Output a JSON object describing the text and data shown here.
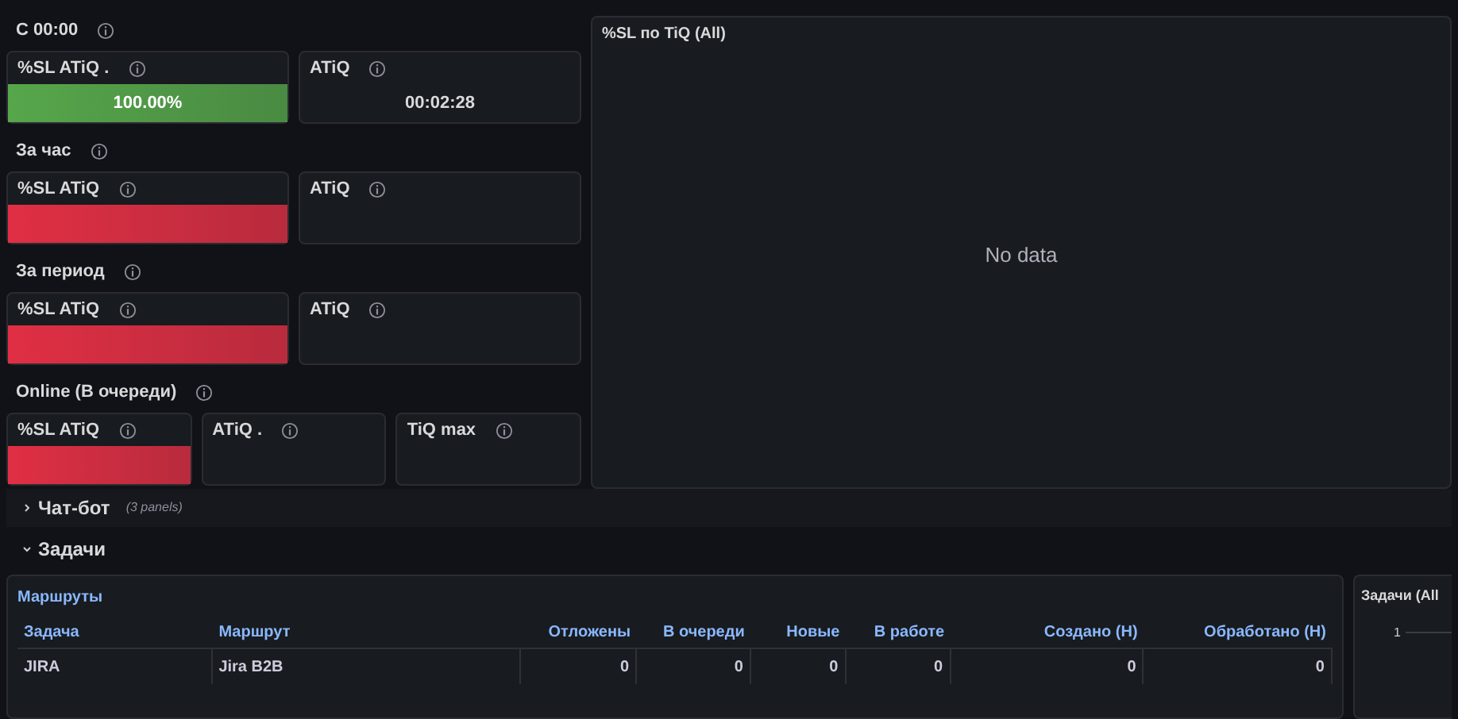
{
  "groups": [
    {
      "title": "С 00:00",
      "panels": [
        {
          "kind": "bar",
          "title": "%SL ATiQ .",
          "color": "#56a64b",
          "value": "100.00%"
        },
        {
          "kind": "value",
          "title": "ATiQ",
          "value": "00:02:28"
        }
      ]
    },
    {
      "title": "За час",
      "panels": [
        {
          "kind": "bar",
          "title": "%SL ATiQ",
          "color": "#e02f44"
        },
        {
          "kind": "value",
          "title": "ATiQ"
        }
      ]
    },
    {
      "title": "За период",
      "panels": [
        {
          "kind": "bar",
          "title": "%SL ATiQ",
          "color": "#e02f44"
        },
        {
          "kind": "value",
          "title": "ATiQ"
        }
      ]
    },
    {
      "title": "Online (В очереди)",
      "panels": [
        {
          "kind": "bar",
          "title": "%SL ATiQ",
          "color": "#e02f44"
        },
        {
          "kind": "value",
          "title": "ATiQ ."
        },
        {
          "kind": "value",
          "title": "TiQ max"
        }
      ]
    }
  ],
  "sl_panel": {
    "title": "%SL по TiQ (All)",
    "message": "No data"
  },
  "rows": [
    {
      "title": "Чат-бот",
      "expanded": false,
      "note": "(3 panels)"
    },
    {
      "title": "Задачи",
      "expanded": true
    }
  ],
  "table": {
    "title": "Маршруты",
    "columns": [
      "Задача",
      "Маршрут",
      "Отложены",
      "В очереди",
      "Новые",
      "В работе",
      "Создано (Н)",
      "Обработано (Н)"
    ],
    "rows": [
      [
        "JIRA",
        "Jira B2B",
        "0",
        "0",
        "0",
        "0",
        "0",
        "0"
      ]
    ]
  },
  "tasks_panel": {
    "title": "Задачи (All",
    "ytick": "1"
  }
}
